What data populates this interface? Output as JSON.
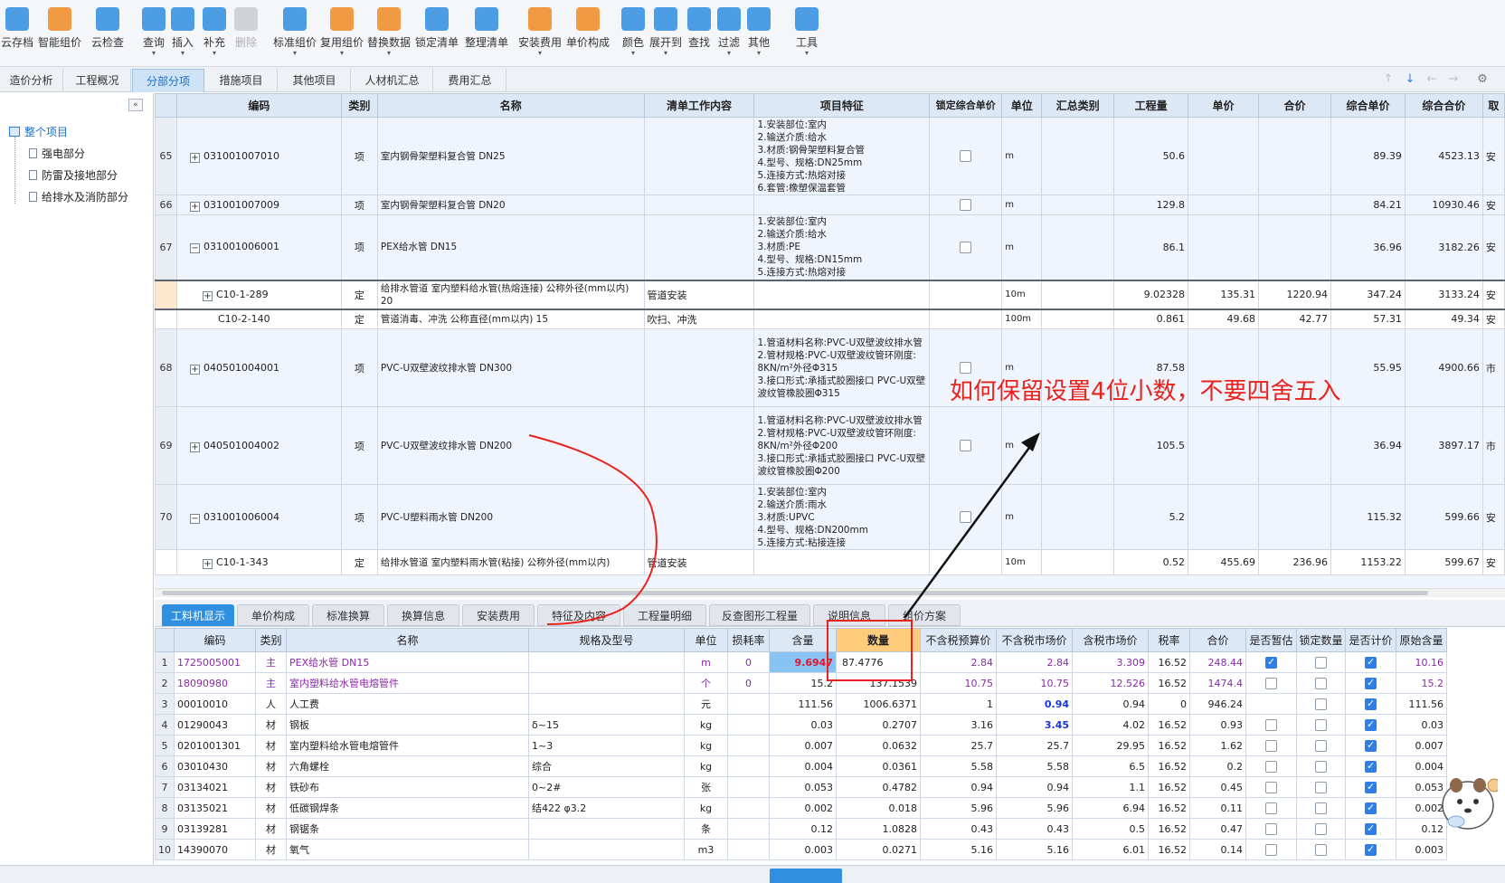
{
  "toolbar": {
    "buttons": [
      {
        "label": "云存档",
        "icon": "cloud-save-icon",
        "color": "#2e8de0"
      },
      {
        "label": "智能组价",
        "icon": "smart-pricing-icon",
        "color": "#f08a24"
      },
      {
        "label": "云检查",
        "icon": "cloud-check-icon",
        "color": "#2e8de0"
      },
      {
        "label": "查询",
        "icon": "query-icon",
        "color": "#2e8de0"
      },
      {
        "label": "插入",
        "icon": "insert-icon",
        "color": "#2e8de0"
      },
      {
        "label": "补充",
        "icon": "supplement-icon",
        "color": "#2e8de0"
      },
      {
        "label": "删除",
        "icon": "delete-icon",
        "color": "#b0b0b0"
      },
      {
        "label": "标准组价",
        "icon": "standard-pricing-icon",
        "color": "#2e8de0"
      },
      {
        "label": "复用组价",
        "icon": "reuse-pricing-icon",
        "color": "#f08a24"
      },
      {
        "label": "替换数据",
        "icon": "replace-data-icon",
        "color": "#f08a24"
      },
      {
        "label": "锁定清单",
        "icon": "lock-list-icon",
        "color": "#2e8de0"
      },
      {
        "label": "整理清单",
        "icon": "organize-list-icon",
        "color": "#2e8de0"
      },
      {
        "label": "安装费用",
        "icon": "install-fee-icon",
        "color": "#f08a24"
      },
      {
        "label": "单价构成",
        "icon": "unit-price-icon",
        "color": "#f08a24"
      },
      {
        "label": "颜色",
        "icon": "color-icon",
        "color": "#2e8de0"
      },
      {
        "label": "展开到",
        "icon": "expand-to-icon",
        "color": "#2e8de0"
      },
      {
        "label": "查找",
        "icon": "find-icon",
        "color": "#2e8de0"
      },
      {
        "label": "过滤",
        "icon": "filter-icon",
        "color": "#2e8de0"
      },
      {
        "label": "其他",
        "icon": "other-icon",
        "color": "#2e8de0"
      },
      {
        "label": "工具",
        "icon": "tools-icon",
        "color": "#2e8de0"
      }
    ]
  },
  "tabs": [
    "造价分析",
    "工程概况",
    "分部分项",
    "措施项目",
    "其他项目",
    "人材机汇总",
    "费用汇总"
  ],
  "active_tab": "分部分项",
  "tree": {
    "root": "整个项目",
    "children": [
      "强电部分",
      "防雷及接地部分",
      "给排水及消防部分"
    ]
  },
  "upper_table": {
    "headers": [
      "编码",
      "类别",
      "名称",
      "清单工作内容",
      "项目特征",
      "锁定综合单价",
      "单位",
      "汇总类别",
      "工程量",
      "单价",
      "合价",
      "综合单价",
      "综合合价",
      "取"
    ],
    "rows": [
      {
        "num": "65",
        "exp": "+",
        "code": "031001007010",
        "type": "项",
        "name": "室内钢骨架塑料复合管 DN25",
        "work": "",
        "feature": "1.安装部位:室内\n2.输送介质:给水\n3.材质:钢骨架塑料复合管\n4.型号、规格:DN25mm\n5.连接方式:热熔对接\n6.套管:橡塑保温套管",
        "unit": "m",
        "qty": "50.6",
        "price": "",
        "total": "",
        "cprice": "89.39",
        "ctotal": "4523.13",
        "tail": "安"
      },
      {
        "num": "66",
        "exp": "+",
        "code": "031001007009",
        "type": "项",
        "name": "室内钢骨架塑料复合管 DN20",
        "work": "",
        "feature": "",
        "unit": "m",
        "qty": "129.8",
        "price": "",
        "total": "",
        "cprice": "84.21",
        "ctotal": "10930.46",
        "tail": "安"
      },
      {
        "num": "67",
        "exp": "−",
        "code": "031001006001",
        "type": "项",
        "name": "PEX给水管 DN15",
        "work": "",
        "feature": "1.安装部位:室内\n2.输送介质:给水\n3.材质:PE\n4.型号、规格:DN15mm\n5.连接方式:热熔对接",
        "unit": "m",
        "qty": "86.1",
        "price": "",
        "total": "",
        "cprice": "36.96",
        "ctotal": "3182.26",
        "tail": "安"
      },
      {
        "num": "",
        "exp": "+",
        "code": "C10-1-289",
        "type": "定",
        "name": "给排水管道 室内塑料给水管(热熔连接) 公称外径(mm以内) 20",
        "work": "管道安装",
        "feature": "",
        "unit": "10m",
        "qty": "9.02328",
        "price": "135.31",
        "total": "1220.94",
        "cprice": "347.24",
        "ctotal": "3133.24",
        "tail": "安",
        "sub": true,
        "selected": true
      },
      {
        "num": "",
        "exp": "",
        "code": "C10-2-140",
        "type": "定",
        "name": "管道消毒、冲洗 公称直径(mm以内) 15",
        "work": "吹扫、冲洗",
        "feature": "",
        "unit": "100m",
        "qty": "0.861",
        "price": "49.68",
        "total": "42.77",
        "cprice": "57.31",
        "ctotal": "49.34",
        "tail": "安",
        "sub": true
      },
      {
        "num": "68",
        "exp": "+",
        "code": "040501004001",
        "type": "项",
        "name": "PVC-U双壁波纹排水管 DN300",
        "work": "",
        "feature": "1.管道材料名称:PVC-U双壁波纹排水管\n2.管材规格:PVC-U双壁波纹管环刚度: 8KN/m²外径Φ315\n3.接口形式:承插式胶圈接口 PVC-U双壁波纹管橡胶圈Φ315",
        "unit": "m",
        "qty": "87.58",
        "price": "",
        "total": "",
        "cprice": "55.95",
        "ctotal": "4900.66",
        "tail": "市"
      },
      {
        "num": "69",
        "exp": "+",
        "code": "040501004002",
        "type": "项",
        "name": "PVC-U双壁波纹排水管 DN200",
        "work": "",
        "feature": "1.管道材料名称:PVC-U双壁波纹排水管\n2.管材规格:PVC-U双壁波纹管环刚度: 8KN/m²外径Φ200\n3.接口形式:承插式胶圈接口 PVC-U双壁波纹管橡胶圈Φ200",
        "unit": "m",
        "qty": "105.5",
        "price": "",
        "total": "",
        "cprice": "36.94",
        "ctotal": "3897.17",
        "tail": "市"
      },
      {
        "num": "70",
        "exp": "−",
        "code": "031001006004",
        "type": "项",
        "name": "PVC-U塑料雨水管 DN200",
        "work": "",
        "feature": "1.安装部位:室内\n2.输送介质:雨水\n3.材质:UPVC\n4.型号、规格:DN200mm\n5.连接方式:粘接连接",
        "unit": "m",
        "qty": "5.2",
        "price": "",
        "total": "",
        "cprice": "115.32",
        "ctotal": "599.66",
        "tail": "安"
      },
      {
        "num": "",
        "exp": "+",
        "code": "C10-1-343",
        "type": "定",
        "name": "给排水管道 室内塑料雨水管(粘接) 公称外径(mm以内)",
        "work": "管道安装",
        "feature": "",
        "unit": "10m",
        "qty": "0.52",
        "price": "455.69",
        "total": "236.96",
        "cprice": "1153.22",
        "ctotal": "599.67",
        "tail": "安",
        "sub": true
      }
    ]
  },
  "bottom_tabs": [
    "工料机显示",
    "单价构成",
    "标准换算",
    "换算信息",
    "安装费用",
    "特征及内容",
    "工程量明细",
    "反查图形工程量",
    "说明信息",
    "组价方案"
  ],
  "active_bottom_tab": "工料机显示",
  "lower_table": {
    "headers": [
      "编码",
      "类别",
      "名称",
      "规格及型号",
      "单位",
      "损耗率",
      "含量",
      "数量",
      "不含税预算价",
      "不含税市场价",
      "含税市场价",
      "税率",
      "合价",
      "是否暂估",
      "锁定数量",
      "是否计价",
      "原始含量"
    ],
    "rows": [
      {
        "num": "1",
        "code": "17250050​01",
        "type": "主",
        "name": "PEX给水管 DN15",
        "spec": "",
        "unit": "m",
        "loss": "0",
        "content": "9.6947",
        "qty": "87.4776",
        "budget": "2.84",
        "market": "2.84",
        "taxm": "3.309",
        "rate": "16.52",
        "total": "248.44",
        "est": true,
        "lock": false,
        "priced": true,
        "orig": "10.16",
        "purple": true
      },
      {
        "num": "2",
        "code": "18090980",
        "type": "主",
        "name": "室内塑料给水管电熔管件",
        "spec": "",
        "unit": "个",
        "loss": "0",
        "content": "15.2",
        "qty": "137.1539",
        "budget": "10.75",
        "market": "10.75",
        "taxm": "12.526",
        "rate": "16.52",
        "total": "1474.4",
        "est": false,
        "lock": false,
        "priced": true,
        "orig": "15.2",
        "purple": true
      },
      {
        "num": "3",
        "code": "00010010",
        "type": "人",
        "name": "人工费",
        "spec": "",
        "unit": "元",
        "loss": "",
        "content": "111.56",
        "qty": "1006.6371",
        "budget": "1",
        "market": "0.94",
        "taxm": "0.94",
        "rate": "0",
        "total": "946.24",
        "est": null,
        "lock": false,
        "priced": true,
        "orig": "111.56",
        "market_blue": true
      },
      {
        "num": "4",
        "code": "01290043",
        "type": "材",
        "name": "钢板",
        "spec": "δ~15",
        "unit": "kg",
        "loss": "",
        "content": "0.03",
        "qty": "0.2707",
        "budget": "3.16",
        "market": "3.45",
        "taxm": "4.02",
        "rate": "16.52",
        "total": "0.93",
        "est": false,
        "lock": false,
        "priced": true,
        "orig": "0.03",
        "market_blue": true
      },
      {
        "num": "5",
        "code": "0201001301",
        "type": "材",
        "name": "室内塑料给水管电熔管件",
        "spec": "1~3",
        "unit": "kg",
        "loss": "",
        "content": "0.007",
        "qty": "0.0632",
        "budget": "25.7",
        "market": "25.7",
        "taxm": "29.95",
        "rate": "16.52",
        "total": "1.62",
        "est": false,
        "lock": false,
        "priced": true,
        "orig": "0.007"
      },
      {
        "num": "6",
        "code": "03010430",
        "type": "材",
        "name": "六角螺栓",
        "spec": "综合",
        "unit": "kg",
        "loss": "",
        "content": "0.004",
        "qty": "0.0361",
        "budget": "5.58",
        "market": "5.58",
        "taxm": "6.5",
        "rate": "16.52",
        "total": "0.2",
        "est": false,
        "lock": false,
        "priced": true,
        "orig": "0.004"
      },
      {
        "num": "7",
        "code": "03134021",
        "type": "材",
        "name": "铁砂布",
        "spec": "0~2#",
        "unit": "张",
        "loss": "",
        "content": "0.053",
        "qty": "0.4782",
        "budget": "0.94",
        "market": "0.94",
        "taxm": "1.1",
        "rate": "16.52",
        "total": "0.45",
        "est": false,
        "lock": false,
        "priced": true,
        "orig": "0.053"
      },
      {
        "num": "8",
        "code": "03135021",
        "type": "材",
        "name": "低碳钢焊条",
        "spec": "结422 φ3.2",
        "unit": "kg",
        "loss": "",
        "content": "0.002",
        "qty": "0.018",
        "budget": "5.96",
        "market": "5.96",
        "taxm": "6.94",
        "rate": "16.52",
        "total": "0.11",
        "est": false,
        "lock": false,
        "priced": true,
        "orig": "0.002"
      },
      {
        "num": "9",
        "code": "03139281",
        "type": "材",
        "name": "钢锯条",
        "spec": "",
        "unit": "条",
        "loss": "",
        "content": "0.12",
        "qty": "1.0828",
        "budget": "0.43",
        "market": "0.43",
        "taxm": "0.5",
        "rate": "16.52",
        "total": "0.47",
        "est": false,
        "lock": false,
        "priced": true,
        "orig": "0.12"
      },
      {
        "num": "10",
        "code": "14390070",
        "type": "材",
        "name": "氧气",
        "spec": "",
        "unit": "m3",
        "loss": "",
        "content": "0.003",
        "qty": "0.0271",
        "budget": "5.16",
        "market": "5.16",
        "taxm": "6.01",
        "rate": "16.52",
        "total": "0.14",
        "est": false,
        "lock": false,
        "priced": true,
        "orig": "0.003"
      }
    ]
  },
  "annotation": {
    "text": "如何保留设置4位小数，不要四舍五入",
    "color": "#e8231d"
  },
  "colors": {
    "accent": "#2f8fe0",
    "highlight_header": "#ffcb7d",
    "selected_content": "#87c3f3",
    "content_text": "#e0162b",
    "purple_text": "#8a2ba8"
  }
}
